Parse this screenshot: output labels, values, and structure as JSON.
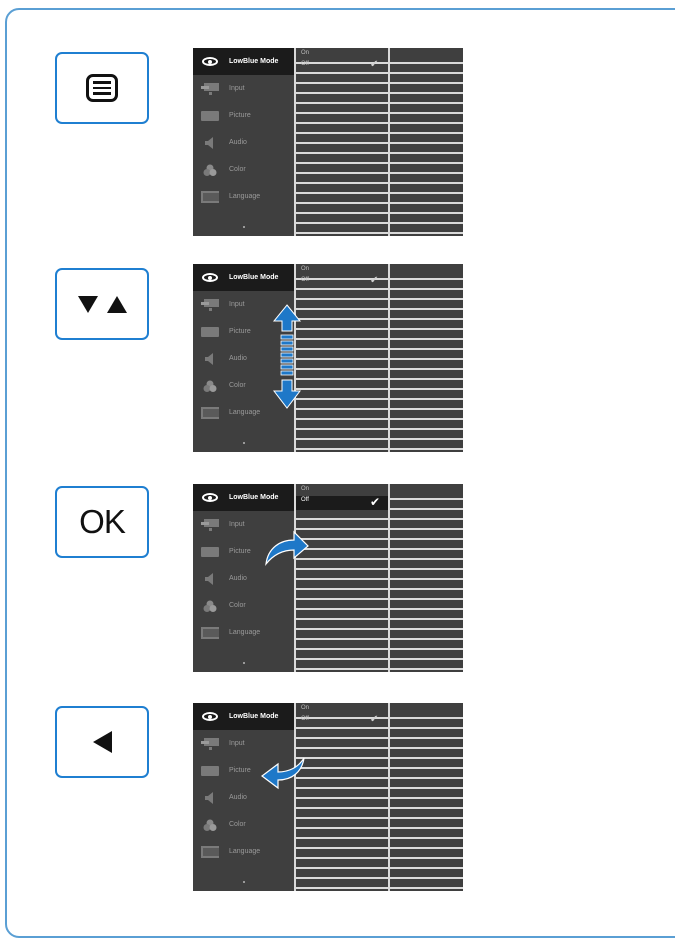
{
  "steps": [
    {
      "key": "menu",
      "key_icon": "menu-icon"
    },
    {
      "key": "down-up",
      "key_icon": "down-up-arrows-icon"
    },
    {
      "key": "ok",
      "key_label": "OK"
    },
    {
      "key": "back",
      "key_icon": "left-triangle-icon"
    }
  ],
  "osd": {
    "menu_items": [
      "LowBlue Mode",
      "Input",
      "Picture",
      "Audio",
      "Color",
      "Language"
    ],
    "menu_icons": [
      "eye-icon",
      "input-icon",
      "picture-icon",
      "audio-icon",
      "color-icon",
      "language-icon"
    ],
    "options": [
      "On",
      "Off"
    ],
    "selected_option": "Off"
  },
  "colors": {
    "key_border": "#1f7fd1",
    "arrow": "#1e78c8",
    "osd_bg": "#3f3f3f"
  }
}
